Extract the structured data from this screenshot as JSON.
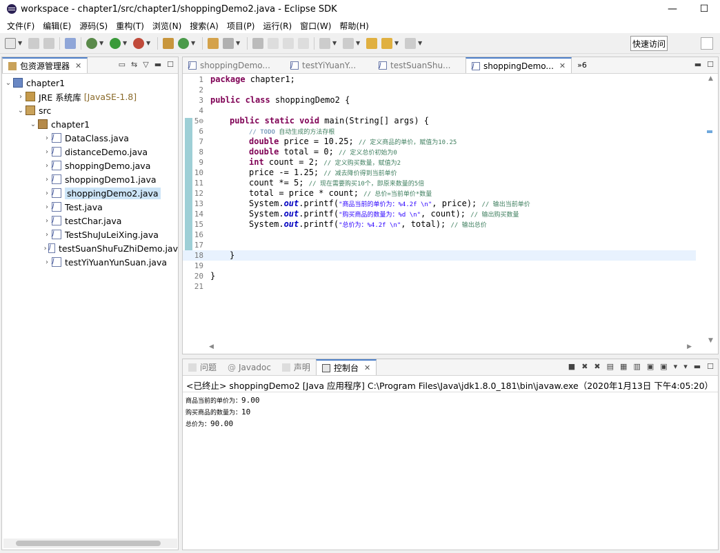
{
  "window": {
    "title": "workspace - chapter1/src/chapter1/shoppingDemo2.java - Eclipse SDK",
    "minimize": "—",
    "maximize": "☐"
  },
  "menu": [
    "文件(F)",
    "编辑(E)",
    "源码(S)",
    "重构(T)",
    "浏览(N)",
    "搜索(A)",
    "项目(P)",
    "运行(R)",
    "窗口(W)",
    "帮助(H)"
  ],
  "toolbar": {
    "quick_access": "快速访问"
  },
  "explorer": {
    "tab_label": "包资源管理器",
    "tab_close": "✕",
    "tree": [
      {
        "label": "chapter1",
        "arrow": "⌄",
        "icon": "project-icon",
        "depth": 0
      },
      {
        "label": "JRE 系统库",
        "suffix": "[JavaSE-1.8]",
        "arrow": "›",
        "icon": "library-icon",
        "depth": 1
      },
      {
        "label": "src",
        "arrow": "⌄",
        "icon": "source-folder-icon",
        "depth": 1
      },
      {
        "label": "chapter1",
        "arrow": "⌄",
        "icon": "package-icon",
        "depth": 2
      },
      {
        "label": "DataClass.java",
        "arrow": "›",
        "icon": "java-file-icon",
        "depth": 3
      },
      {
        "label": "distanceDemo.java",
        "arrow": "›",
        "icon": "java-file-icon",
        "depth": 3
      },
      {
        "label": "shoppingDemo.java",
        "arrow": "›",
        "icon": "java-file-icon",
        "depth": 3
      },
      {
        "label": "shoppingDemo1.java",
        "arrow": "›",
        "icon": "java-file-icon",
        "depth": 3
      },
      {
        "label": "shoppingDemo2.java",
        "arrow": "›",
        "icon": "java-file-icon",
        "depth": 3,
        "selected": true
      },
      {
        "label": "Test.java",
        "arrow": "›",
        "icon": "java-file-icon",
        "depth": 3
      },
      {
        "label": "testChar.java",
        "arrow": "›",
        "icon": "java-file-icon",
        "depth": 3
      },
      {
        "label": "TestShuJuLeiXing.java",
        "arrow": "›",
        "icon": "java-file-icon",
        "depth": 3
      },
      {
        "label": "testSuanShuFuZhiDemo.jav",
        "arrow": "›",
        "icon": "java-file-icon",
        "depth": 3
      },
      {
        "label": "testYiYuanYunSuan.java",
        "arrow": "›",
        "icon": "java-file-icon",
        "depth": 3
      }
    ]
  },
  "editor": {
    "tabs": [
      {
        "label": "shoppingDemo...",
        "active": false
      },
      {
        "label": "testYiYuanY...",
        "active": false
      },
      {
        "label": "testSuanShu...",
        "active": false
      },
      {
        "label": "shoppingDemo...",
        "active": true
      }
    ],
    "overflow": "»6",
    "line_numbers": [
      "1",
      "2",
      "3",
      "4",
      "5⊖",
      "6",
      "7",
      "8",
      "9",
      "10",
      "11",
      "12",
      "13",
      "14",
      "15",
      "16",
      "17",
      "18",
      "19",
      "20",
      "21"
    ],
    "code": {
      "l1": "package chapter1;",
      "l3_kw": "public class",
      "l3_rest": " shoppingDemo2 {",
      "l5_kw": "public static void",
      "l5_rest": " main(String[] args) {",
      "l6_todo": "// TODO",
      "l6_cm": " 自动生成的方法存根",
      "l7_kw": "double",
      "l7_rest": " price = 10.25; ",
      "l7_cm": "// 定义商品的单价，赋值为10.25",
      "l8_kw": "double",
      "l8_rest": " total = 0; ",
      "l8_cm": "// 定义总价初始为0",
      "l9_kw": "int",
      "l9_rest": " count = 2; ",
      "l9_cm": "// 定义购买数量，赋值为2",
      "l10_rest": "price -= 1.25; ",
      "l10_cm": "// 减去降价得到当前单价",
      "l11_rest": "count *= 5; ",
      "l11_cm": "// 现在需要购买10个，即原来数量的5倍",
      "l12_rest": "total = price * count; ",
      "l12_cm": "// 总价=当前单价*数量",
      "l13_a": "System.",
      "l13_fld": "out",
      "l13_b": ".printf(",
      "l13_str": "\"商品当前的单价为：%4.2f \\n\"",
      "l13_c": ", price); ",
      "l13_cm": "// 输出当前单价",
      "l14_a": "System.",
      "l14_fld": "out",
      "l14_b": ".printf(",
      "l14_str": "\"购买商品的数量为：%d \\n\"",
      "l14_c": ", count); ",
      "l14_cm": "// 输出购买数量",
      "l15_a": "System.",
      "l15_fld": "out",
      "l15_b": ".printf(",
      "l15_str": "\"总价为：%4.2f \\n\"",
      "l15_c": ", total); ",
      "l15_cm": "// 输出总价",
      "l18": "}",
      "l20": "}"
    }
  },
  "console": {
    "tabs": [
      {
        "label": "问题",
        "active": false
      },
      {
        "label": "Javadoc",
        "active": false
      },
      {
        "label": "声明",
        "active": false
      },
      {
        "label": "控制台",
        "active": true
      }
    ],
    "header": "<已终止> shoppingDemo2 [Java 应用程序] C:\\Program Files\\Java\\jdk1.8.0_181\\bin\\javaw.exe（2020年1月13日 下午4:05:20）",
    "output": [
      {
        "label": "商品当前的单价为：",
        "value": "9.00"
      },
      {
        "label": "购买商品的数量为：",
        "value": "10"
      },
      {
        "label": "总价为：",
        "value": "90.00"
      }
    ]
  },
  "colors": {
    "keyword": "#7f0055",
    "comment": "#3f7f5f",
    "string": "#2a00ff",
    "field": "#0000c0",
    "selection": "#cce4f7",
    "active_tab_accent": "#4d7fc9"
  }
}
